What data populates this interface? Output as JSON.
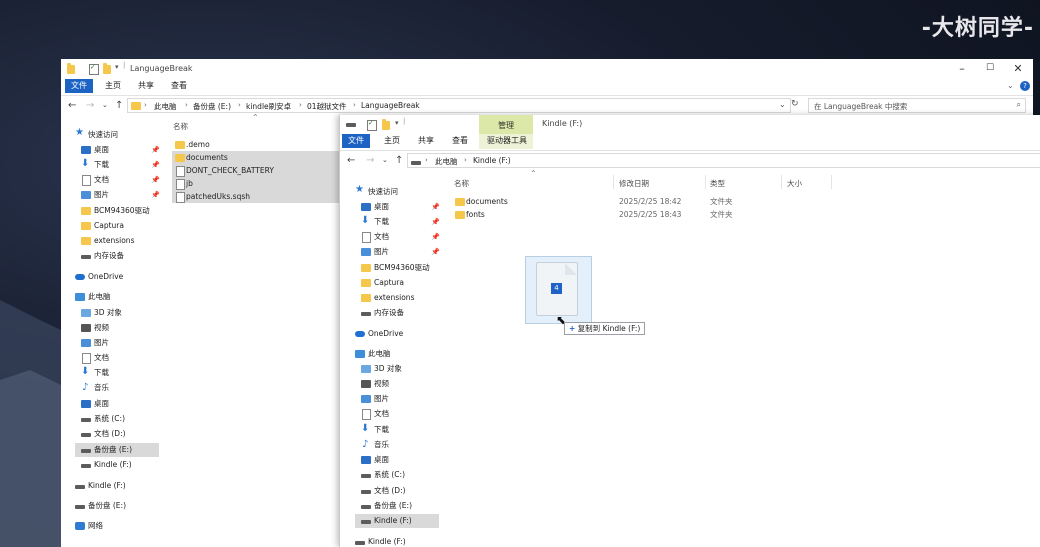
{
  "watermark": "-大树同学-",
  "win1": {
    "title": "LanguageBreak",
    "tabs": [
      "文件",
      "主页",
      "共享",
      "查看"
    ],
    "address": [
      "此电脑",
      "备份盘 (E:)",
      "kindle刷安卓",
      "01越狱文件",
      "LanguageBreak"
    ],
    "search_placeholder": "在 LanguageBreak 中搜索",
    "col_name": "名称",
    "files": [
      ".demo",
      "documents",
      "DONT_CHECK_BATTERY",
      "jb",
      "patchedUks.sqsh"
    ],
    "nav": {
      "quick_access": "快速访问",
      "desktop": "桌面",
      "downloads": "下载",
      "docs": "文档",
      "pictures": "图片",
      "bcm": "BCM94360驱动",
      "captura": "Captura",
      "extensions": "extensions",
      "storage": "内存设备",
      "onedrive": "OneDrive",
      "this_pc": "此电脑",
      "objects3d": "3D 对象",
      "videos": "视频",
      "pictures2": "图片",
      "docs2": "文档",
      "downloads2": "下载",
      "music": "音乐",
      "desktop2": "桌面",
      "drive_c": "系统 (C:)",
      "drive_d": "文档 (D:)",
      "drive_e": "备份盘 (E:)",
      "drive_f": "Kindle (F:)",
      "kindle2": "Kindle (F:)",
      "backup2": "备份盘 (E:)",
      "network": "网络"
    }
  },
  "win2": {
    "title": "Kindle (F:)",
    "manage_tab": "管理",
    "driver_tools": "驱动器工具",
    "tabs": [
      "文件",
      "主页",
      "共享",
      "查看"
    ],
    "address": [
      "此电脑",
      "Kindle (F:)"
    ],
    "columns": [
      "名称",
      "修改日期",
      "类型",
      "大小"
    ],
    "rows": [
      {
        "name": "documents",
        "date": "2025/2/25 18:42",
        "type": "文件夹"
      },
      {
        "name": "fonts",
        "date": "2025/2/25 18:43",
        "type": "文件夹"
      }
    ],
    "nav": {
      "quick_access": "快速访问",
      "desktop": "桌面",
      "downloads": "下载",
      "docs": "文档",
      "pictures": "图片",
      "bcm": "BCM94360驱动",
      "captura": "Captura",
      "extensions": "extensions",
      "storage": "内存设备",
      "onedrive": "OneDrive",
      "this_pc": "此电脑",
      "objects3d": "3D 对象",
      "videos": "视频",
      "pictures2": "图片",
      "docs2": "文档",
      "downloads2": "下载",
      "music": "音乐",
      "desktop2": "桌面",
      "drive_c": "系统 (C:)",
      "drive_d": "文档 (D:)",
      "drive_e": "备份盘 (E:)",
      "drive_f": "Kindle (F:)",
      "kindle2": "Kindle (F:)"
    }
  },
  "drag": {
    "count": "4",
    "tooltip": "复制到 Kindle (F:)"
  }
}
